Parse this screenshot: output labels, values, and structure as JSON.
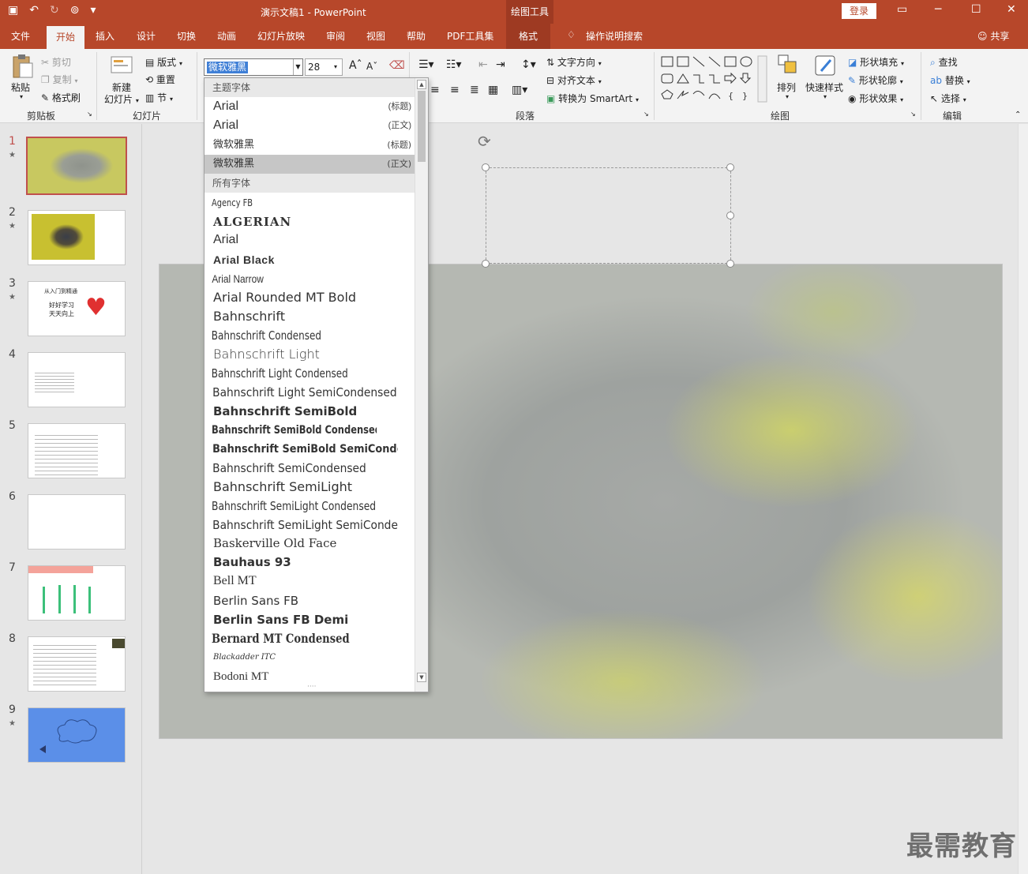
{
  "titlebar": {
    "doc_title": "演示文稿1 - PowerPoint",
    "drawing_tools": "绘图工具",
    "login": "登录"
  },
  "tabs": [
    "文件",
    "开始",
    "插入",
    "设计",
    "切换",
    "动画",
    "幻灯片放映",
    "审阅",
    "视图",
    "帮助",
    "PDF工具集",
    "格式",
    "操作说明搜索",
    "共享"
  ],
  "ribbon": {
    "clipboard": {
      "paste": "粘贴",
      "cut": "剪切",
      "copy": "复制",
      "format_painter": "格式刷",
      "label": "剪贴板"
    },
    "slides": {
      "new_slide_1": "新建",
      "new_slide_2": "幻灯片",
      "layout": "版式",
      "reset": "重置",
      "section": "节",
      "label": "幻灯片"
    },
    "font": {
      "current_font": "微软雅黑",
      "size": "28"
    },
    "paragraph": {
      "text_direction": "文字方向",
      "align_text": "对齐文本",
      "smartart": "转换为 SmartArt",
      "label": "段落"
    },
    "drawing": {
      "arrange": "排列",
      "quick_styles": "快速样式",
      "fill": "形状填充",
      "outline": "形状轮廓",
      "effects": "形状效果",
      "label": "绘图"
    },
    "editing": {
      "find": "查找",
      "replace": "替换",
      "select": "选择",
      "label": "编辑"
    }
  },
  "font_dropdown": {
    "theme_header": "主题字体",
    "theme_fonts": [
      {
        "name": "Arial",
        "tag": "(标题)"
      },
      {
        "name": "Arial",
        "tag": "(正文)"
      },
      {
        "name": "微软雅黑",
        "tag": "(标题)"
      },
      {
        "name": "微软雅黑",
        "tag": "(正文)"
      }
    ],
    "all_header": "所有字体",
    "all_fonts": [
      "Agency FB",
      "ALGERIAN",
      "Arial",
      "Arial Black",
      "Arial Narrow",
      "Arial Rounded MT Bold",
      "Bahnschrift",
      "Bahnschrift Condensed",
      "Bahnschrift Light",
      "Bahnschrift Light Condensed",
      "Bahnschrift Light SemiCondensed",
      "Bahnschrift SemiBold",
      "Bahnschrift SemiBold Condensed",
      "Bahnschrift SemiBold SemiConden",
      "Bahnschrift SemiCondensed",
      "Bahnschrift SemiLight",
      "Bahnschrift SemiLight Condensed",
      "Bahnschrift SemiLight SemiConde",
      "Baskerville Old Face",
      "Bauhaus 93",
      "Bell MT",
      "Berlin Sans FB",
      "Berlin Sans FB Demi",
      "Bernard MT Condensed",
      "Blackadder ITC",
      "Bodoni MT"
    ]
  },
  "slides": [
    "1",
    "2",
    "3",
    "4",
    "5",
    "6",
    "7",
    "8",
    "9"
  ],
  "thumb3": {
    "title": "从入门到精通",
    "line1": "好好学习",
    "line2": "天天向上"
  },
  "watermark": "最需教育"
}
